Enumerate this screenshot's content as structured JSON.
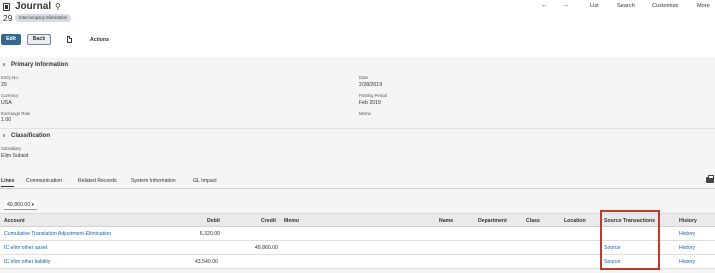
{
  "header": {
    "title": "Journal",
    "record_number": "29",
    "badge": "Intercompany Elimination",
    "nav": {
      "list": "List",
      "search": "Search",
      "customize": "Customize",
      "more": "More"
    },
    "back_arrow": "←",
    "forward_arrow": "→",
    "search_glyph": "⚲"
  },
  "toolbar": {
    "edit": "Edit",
    "back": "Back",
    "actions": "Actions"
  },
  "primary_information": {
    "heading": "Primary Information",
    "chevron": "∨",
    "fields_left": [
      {
        "label": "Entry No.",
        "value": "29"
      },
      {
        "label": "Currency",
        "value": "USA"
      },
      {
        "label": "Exchange Rate",
        "value": "1.00"
      }
    ],
    "fields_right": [
      {
        "label": "Date",
        "value": "2/28/2019"
      },
      {
        "label": "Posting Period",
        "value": "Feb 2019"
      },
      {
        "label": "Memo",
        "value": ""
      }
    ]
  },
  "classification": {
    "heading": "Classification",
    "chevron": "∨",
    "fields": [
      {
        "label": "Subsidiary",
        "value": "Elim Subsid"
      }
    ]
  },
  "subtabs": [
    "Lines",
    "Communication",
    "Related Records",
    "System Information",
    "GL Impact"
  ],
  "lines": {
    "total": "49,860.00",
    "total_caret": "▾",
    "columns": [
      "Account",
      "Debit",
      "Credit",
      "Memo",
      "Name",
      "Department",
      "Class",
      "Location",
      "Source Transactions",
      "History"
    ],
    "rows": [
      {
        "account": "Cumulative Translation Adjustment-Elimination",
        "debit": "6,320.00",
        "credit": "",
        "memo": "",
        "name": "",
        "department": "",
        "class": "",
        "location": "",
        "source": "",
        "history": "History"
      },
      {
        "account": "IC elim other asset",
        "debit": "",
        "credit": "49,860.00",
        "memo": "",
        "name": "",
        "department": "",
        "class": "",
        "location": "",
        "source": "Source",
        "history": "History"
      },
      {
        "account": "IC elim other liability",
        "debit": "43,540.00",
        "credit": "",
        "memo": "",
        "name": "",
        "department": "",
        "class": "",
        "location": "",
        "source": "Source",
        "history": "History"
      }
    ]
  },
  "colors": {
    "primary_button": "#36688e",
    "link": "#1f62a6",
    "highlight_box": "#c0392b"
  },
  "icons": {
    "record": "journal-record-icon",
    "search": "search-icon",
    "document": "document-icon",
    "print": "print-icon"
  }
}
